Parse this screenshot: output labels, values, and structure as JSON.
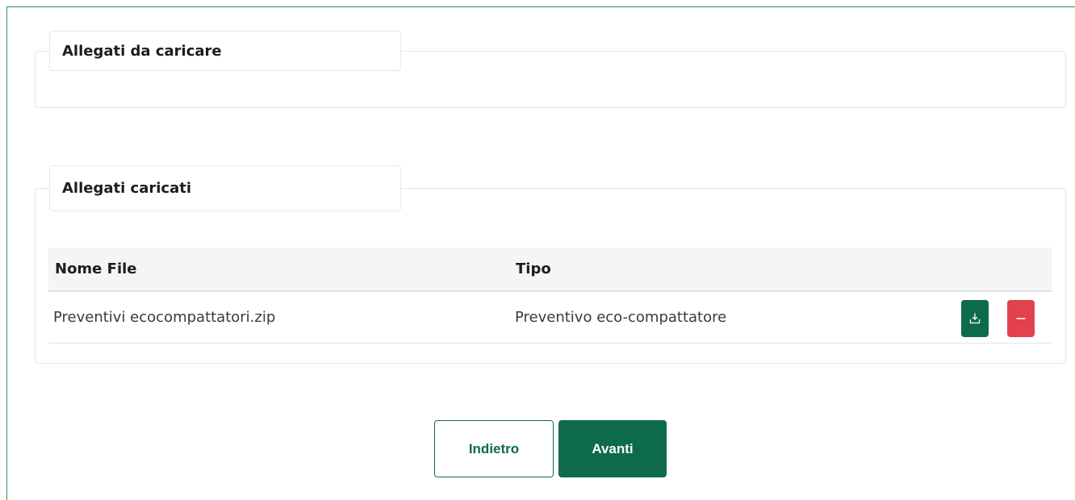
{
  "sections": {
    "to_upload": {
      "title": "Allegati da caricare"
    },
    "uploaded": {
      "title": "Allegati caricati",
      "table": {
        "columns": [
          "Nome File",
          "Tipo"
        ],
        "rows": [
          {
            "name": "Preventivi ecocompattatori.zip",
            "type": "Preventivo eco-compattatore"
          }
        ]
      }
    }
  },
  "actions": {
    "download_icon": "download-icon",
    "remove_icon": "minus-icon",
    "download_color": "#0d6b4b",
    "remove_color": "#e2414d"
  },
  "footer": {
    "back_label": "Indietro",
    "next_label": "Avanti"
  },
  "colors": {
    "accent": "#0d6b4b",
    "frame": "#1f9d4f",
    "danger": "#e2414d"
  }
}
